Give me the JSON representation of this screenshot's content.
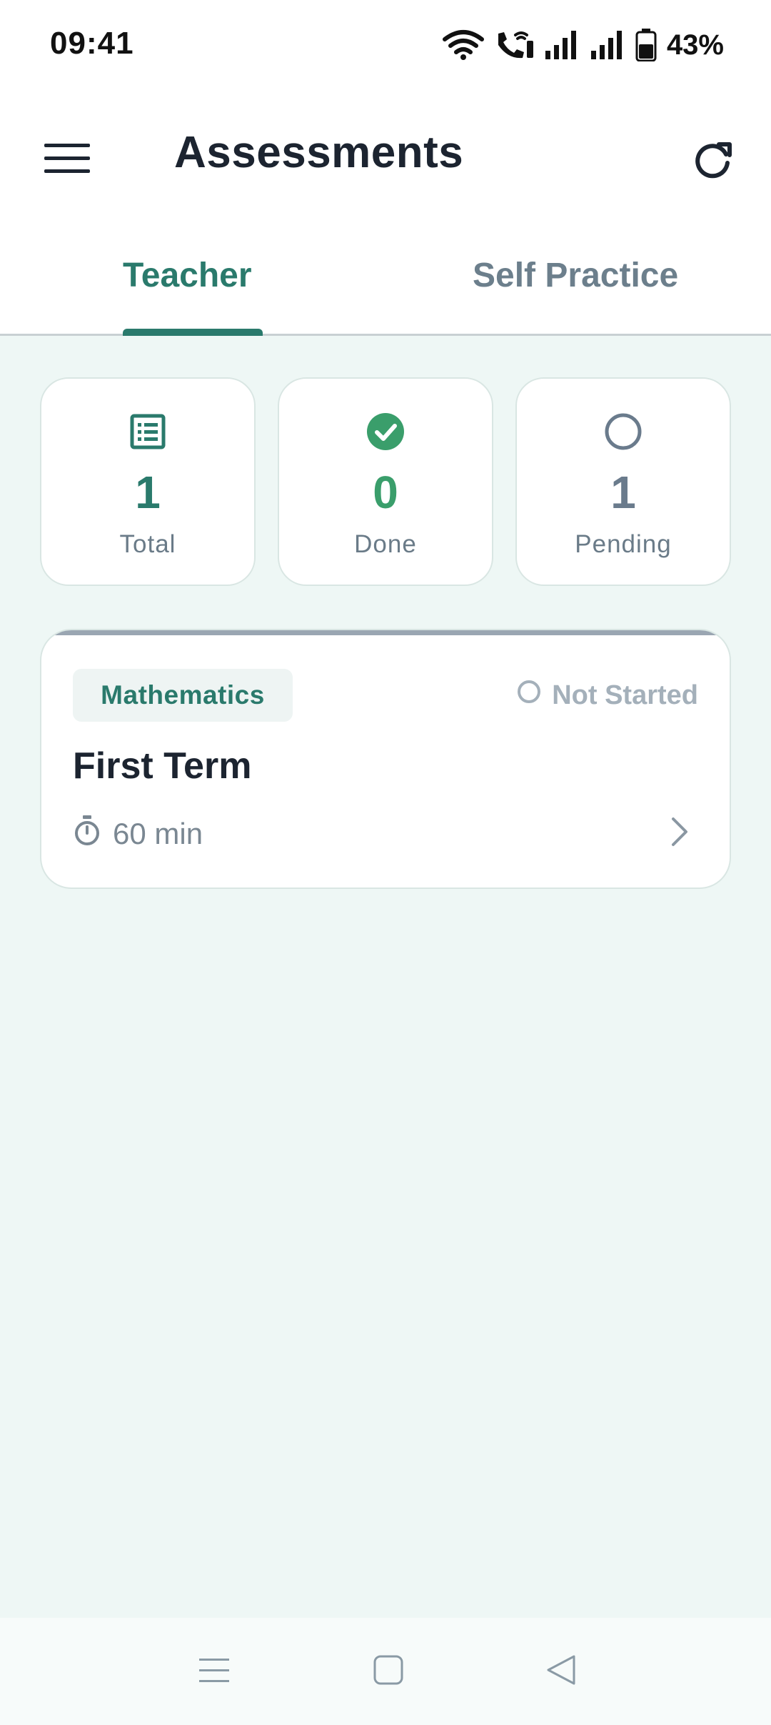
{
  "status_bar": {
    "time": "09:41",
    "battery": "43%",
    "icons": [
      "wifi-icon",
      "wifi-calling-icon",
      "signal-icon",
      "signal-icon",
      "battery-icon"
    ]
  },
  "app_bar": {
    "title": "Assessments",
    "menu_icon": "hamburger-menu-icon",
    "refresh_icon": "refresh-icon"
  },
  "tabs": [
    {
      "label": "Teacher",
      "active": true
    },
    {
      "label": "Self Practice",
      "active": false
    }
  ],
  "stats": [
    {
      "value": "1",
      "label": "Total",
      "icon": "list-icon",
      "color": "#2a7a6c"
    },
    {
      "value": "0",
      "label": "Done",
      "icon": "check-circle-icon",
      "color": "#3a9e6b"
    },
    {
      "value": "1",
      "label": "Pending",
      "icon": "circle-outline-icon",
      "color": "#6a7b8c"
    }
  ],
  "assessments": [
    {
      "subject": "Mathematics",
      "status": "Not Started",
      "title": "First Term",
      "duration": "60 min"
    }
  ],
  "colors": {
    "accent": "#2a7a6c",
    "done": "#3a9e6b",
    "pending": "#6a7b8c",
    "background": "#eef7f5"
  }
}
